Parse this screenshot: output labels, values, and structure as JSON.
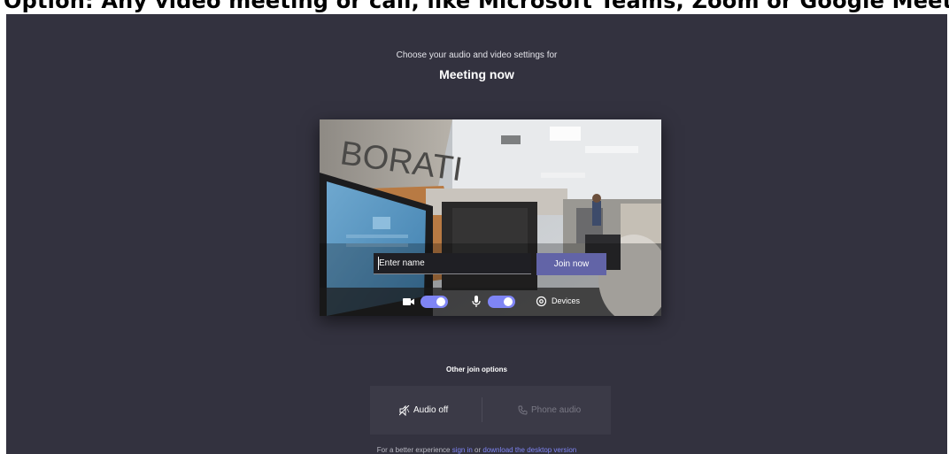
{
  "caption": {
    "text": "Option: Any video meeting or call, like Microsoft Teams, Zoom or Google Meet"
  },
  "prejoin": {
    "subtitle": "Choose your audio and video settings for",
    "title": "Meeting now",
    "name_input": {
      "placeholder": "Enter name",
      "value": ""
    },
    "join_label": "Join now",
    "camera_toggle": {
      "on": true
    },
    "mic_toggle": {
      "on": true
    },
    "devices_label": "Devices",
    "video_preview": {
      "wall_text": "BORATI"
    }
  },
  "other_options": {
    "heading": "Other join options",
    "audio_off_label": "Audio off",
    "phone_audio_label": "Phone audio"
  },
  "footer": {
    "prefix": "For a better experience ",
    "sign_in_link": "sign in",
    "middle": " or ",
    "download_link": "download the desktop version"
  },
  "colors": {
    "background": "#33323f",
    "accent": "#6264a7",
    "toggle_on": "#7f85f5",
    "link": "#7f85f5"
  }
}
